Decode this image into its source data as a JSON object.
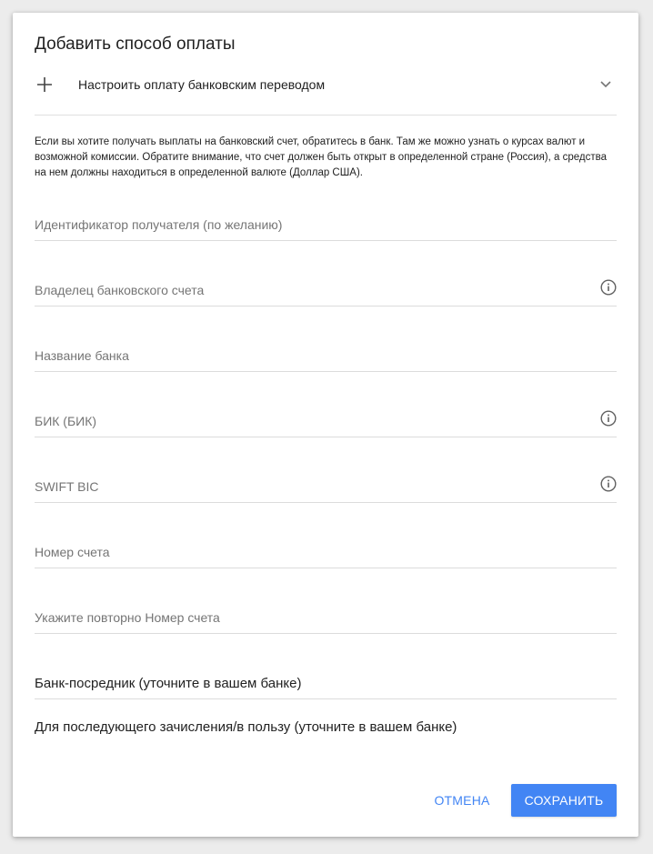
{
  "dialog": {
    "title": "Добавить способ оплаты",
    "expand_label": "Настроить оплату банковским переводом",
    "notice": "Если вы хотите получать выплаты на банковский счет, обратитесь в банк. Там же можно узнать о курсах валют и возможной комиссии. Обратите внимание, что счет должен быть открыт в определенной стране (Россия), а средства на нем должны находиться в определенной валюте (Доллар США).",
    "fields": {
      "recipient_id": {
        "placeholder": "Идентификатор получателя (по желанию)",
        "value": ""
      },
      "account_owner": {
        "placeholder": "Владелец банковского счета",
        "value": ""
      },
      "bank_name": {
        "placeholder": "Название банка",
        "value": ""
      },
      "bik": {
        "placeholder": "БИК (БИК)",
        "value": ""
      },
      "swift": {
        "placeholder": "SWIFT BIC",
        "value": ""
      },
      "account_number": {
        "placeholder": "Номер счета",
        "value": ""
      },
      "account_number_confirm": {
        "placeholder": "Укажите повторно Номер счета",
        "value": ""
      }
    },
    "intermediary_label": "Банк-посредник (уточните в вашем банке)",
    "further_credit_label": "Для последующего зачисления/в пользу (уточните в вашем банке)",
    "buttons": {
      "cancel": "ОТМЕНА",
      "save": "СОХРАНИТЬ"
    }
  },
  "icons": {
    "plus": "plus-icon",
    "chevron": "chevron-down-icon",
    "info": "info-icon"
  },
  "colors": {
    "accent": "#4285f4",
    "text": "#212121",
    "placeholder": "#757575",
    "divider": "#dcdcdc"
  }
}
